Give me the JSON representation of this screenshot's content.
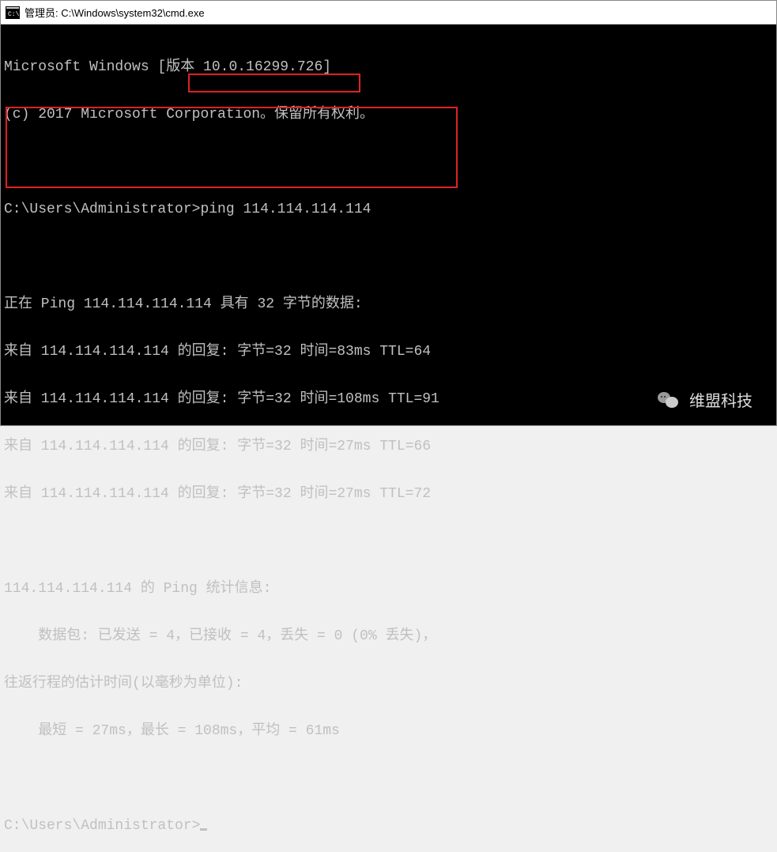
{
  "titlebar": {
    "text": "管理员: C:\\Windows\\system32\\cmd.exe"
  },
  "console": {
    "header_line1": "Microsoft Windows [版本 10.0.16299.726]",
    "header_line2": "(c) 2017 Microsoft Corporation。保留所有权利。",
    "prompt1_path": "C:\\Users\\Administrator>",
    "prompt1_cmd": "ping 114.114.114.114",
    "ping_header": "正在 Ping 114.114.114.114 具有 32 字节的数据:",
    "replies": [
      "来自 114.114.114.114 的回复: 字节=32 时间=83ms TTL=64",
      "来自 114.114.114.114 的回复: 字节=32 时间=108ms TTL=91",
      "来自 114.114.114.114 的回复: 字节=32 时间=27ms TTL=66",
      "来自 114.114.114.114 的回复: 字节=32 时间=27ms TTL=72"
    ],
    "stats_header": "114.114.114.114 的 Ping 统计信息:",
    "stats_packets": "    数据包: 已发送 = 4，已接收 = 4，丢失 = 0 (0% 丢失)，",
    "stats_rtt_header": "往返行程的估计时间(以毫秒为单位):",
    "stats_rtt": "    最短 = 27ms，最长 = 108ms，平均 = 61ms",
    "prompt2_path": "C:\\Users\\Administrator>"
  },
  "watermark": {
    "text": "维盟科技"
  }
}
